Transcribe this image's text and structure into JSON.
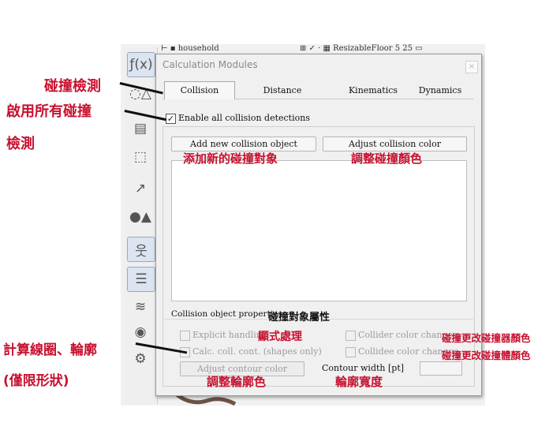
{
  "background": {
    "tree_row": "⊢ ▪ household",
    "tree_row_right": "⊞ ✓ · ▦  ResizableFloor 5 25  ▭"
  },
  "toolbar": {
    "icons": [
      "function-icon",
      "modules-icon",
      "document-icon",
      "box-select-icon",
      "path-icon",
      "shapes-icon",
      "figure-icon",
      "list-icon",
      "layers-icon",
      "render-icon",
      "settings-icon"
    ]
  },
  "dialog": {
    "title": "Calculation Modules",
    "close": "×",
    "tabs": [
      "Collision",
      "Distance",
      "Kinematics",
      "Dynamics"
    ],
    "active_tab": "Collision",
    "enable_all": {
      "label": "Enable all collision detections",
      "checked": true,
      "mark": "✓"
    },
    "add_button": "Add new collision object",
    "adjust_color_button": "Adjust collision color",
    "properties_label": "Collision object properties",
    "explicit_handling": "Explicit handling",
    "calc_contour": "Calc. coll. cont. (shapes only)",
    "collider_color_changes": "Collider color changes",
    "collidee_color_changes": "Collidee color changes",
    "adjust_contour_button": "Adjust contour color",
    "contour_width_label": "Contour width [pt]",
    "contour_width_value": ""
  },
  "annotations": {
    "collision_check": "碰撞檢測",
    "enable_all_line1": "啟用所有碰撞",
    "enable_all_line2": "檢測",
    "add_object": "添加新的碰撞對象",
    "adjust_color": "調整碰撞顏色",
    "object_properties": "碰撞對象屬性",
    "explicit_display": "顯式處理",
    "collider_color": "碰撞更改碰撞器顏色",
    "collidee_color": "碰撞更改碰撞體顏色",
    "calc_contour_line1": "計算線圈、輪廓",
    "calc_contour_line2": "(僅限形狀)",
    "adjust_contour": "調整輪廓色",
    "contour_width": "輪廓寬度"
  },
  "colors": {
    "annotation_red": "#c8102e",
    "dialog_bg": "#f0f0f0"
  }
}
